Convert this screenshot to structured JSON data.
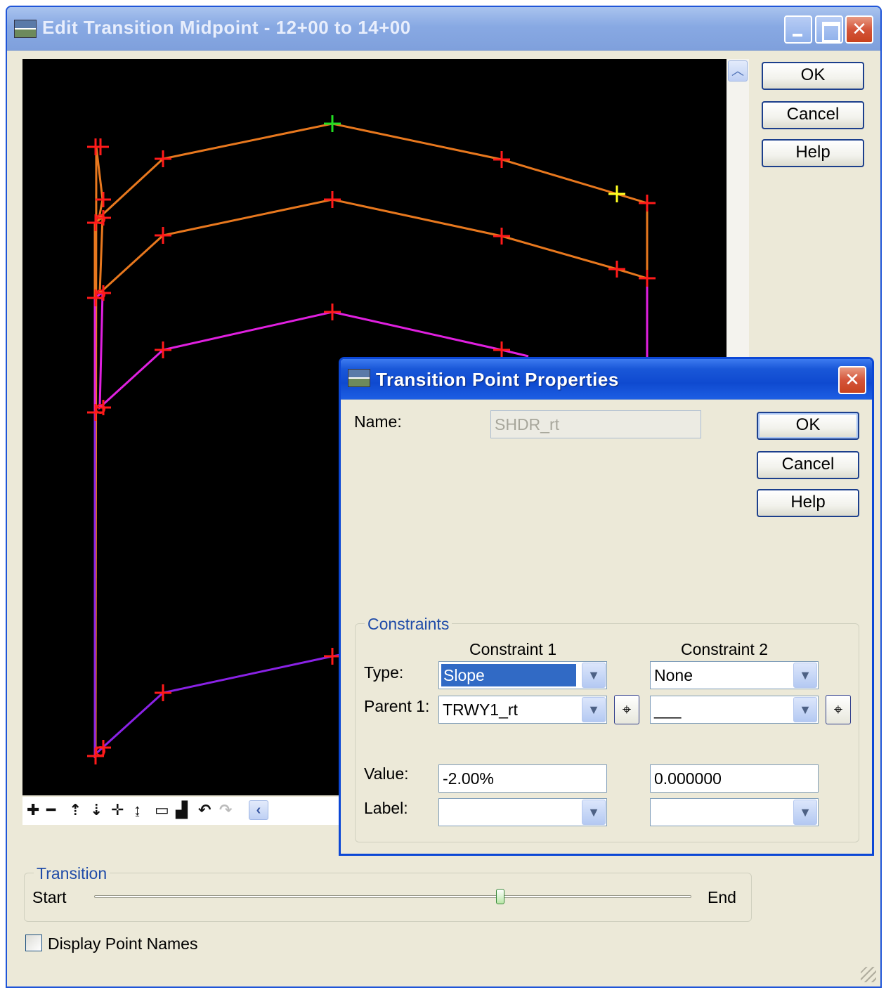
{
  "main_window": {
    "title": "Edit Transition Midpoint - 12+00 to 14+00",
    "buttons": {
      "ok": "OK",
      "cancel": "Cancel",
      "help": "Help"
    }
  },
  "toolbar": {
    "tools": [
      {
        "icon": "zoom-in-icon",
        "glyph": "✚"
      },
      {
        "icon": "zoom-out-icon",
        "glyph": "━"
      },
      {
        "icon": "zoom-extents-icon",
        "glyph": "⇡"
      },
      {
        "icon": "zoom-window-icon",
        "glyph": "⇣"
      },
      {
        "icon": "pan-icon",
        "glyph": "✛"
      },
      {
        "icon": "pan-vertical-icon",
        "glyph": "↨"
      },
      {
        "icon": "view-window-icon",
        "glyph": "▭"
      },
      {
        "icon": "view-fit-icon",
        "glyph": "▟"
      },
      {
        "icon": "undo-icon",
        "glyph": "↶"
      },
      {
        "icon": "redo-icon",
        "glyph": "↷"
      }
    ]
  },
  "transition": {
    "legend": "Transition",
    "start_label": "Start",
    "end_label": "End",
    "slider_value_fraction": 0.68
  },
  "display_point_names": {
    "label": "Display Point Names",
    "checked": false
  },
  "dialog": {
    "title": "Transition Point Properties",
    "name_label": "Name:",
    "name_value": "SHDR_rt",
    "buttons": {
      "ok": "OK",
      "cancel": "Cancel",
      "help": "Help"
    },
    "constraints": {
      "legend": "Constraints",
      "col1_header": "Constraint 1",
      "col2_header": "Constraint 2",
      "type_label": "Type:",
      "parent_label": "Parent 1:",
      "value_label": "Value:",
      "label_label": "Label:",
      "c1": {
        "type": "Slope",
        "parent": "TRWY1_rt",
        "value": "-2.00%",
        "label": ""
      },
      "c2": {
        "type": "None",
        "parent": "___",
        "value": "0.000000",
        "label": ""
      }
    }
  },
  "colors": {
    "canvas_bg": "#000000",
    "orange_line": "#e8781e",
    "magenta_line": "#e020e0",
    "purple_line": "#8a22e6",
    "point_marker": "#ff1a1a",
    "active_point": "#22dd22",
    "selected_point": "#ffff22",
    "title_active": "#0b47d6",
    "group_legend": "#1f4ba8"
  }
}
